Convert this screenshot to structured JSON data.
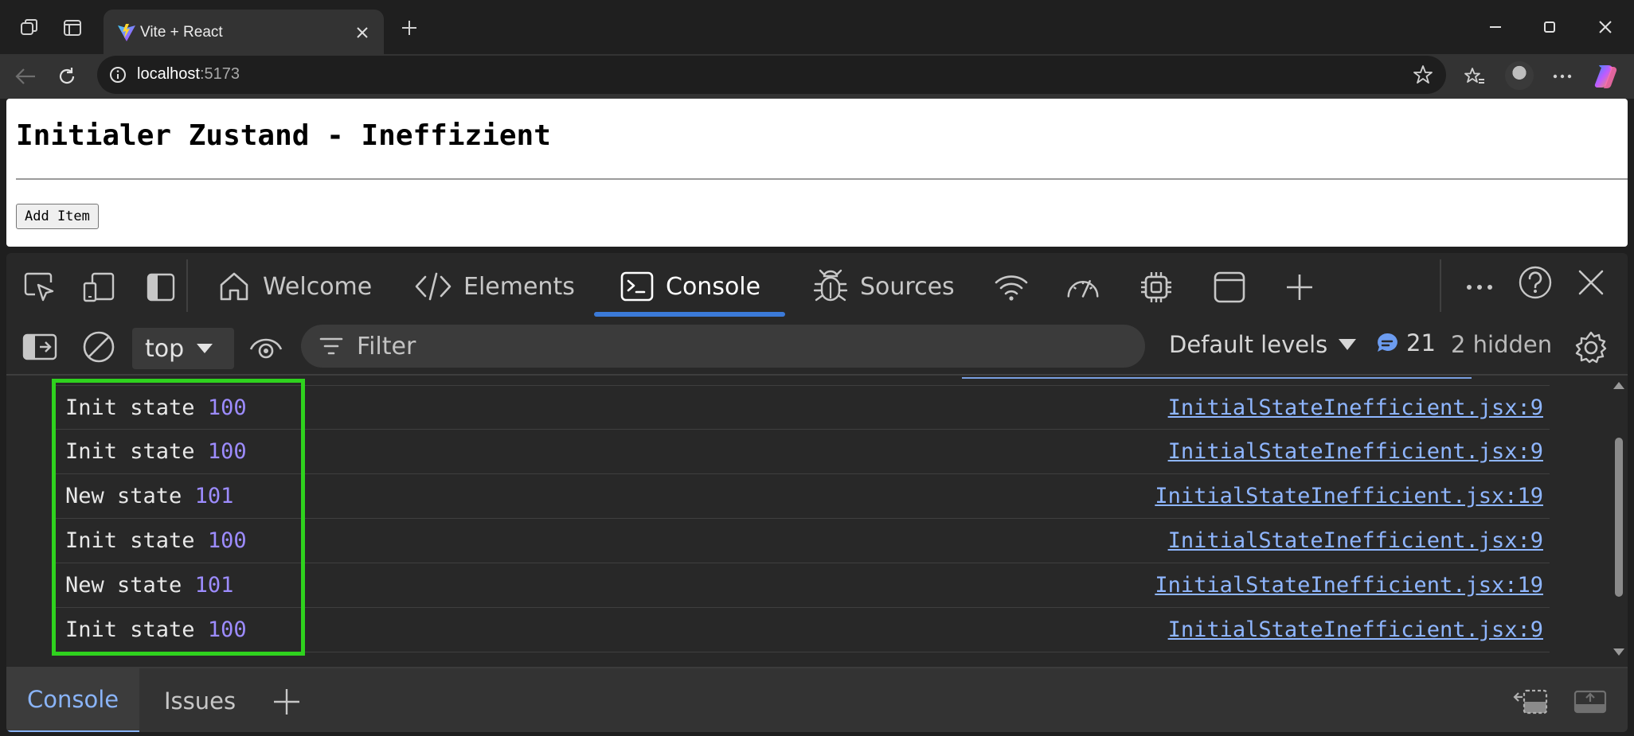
{
  "browser": {
    "tab_title": "Vite + React",
    "url_host": "localhost",
    "url_port": ":5173"
  },
  "page": {
    "heading": "Initialer Zustand - Ineffizient",
    "add_button_label": "Add Item"
  },
  "devtools": {
    "tabs": [
      {
        "label": "Welcome",
        "icon": "home-icon"
      },
      {
        "label": "Elements",
        "icon": "code-icon"
      },
      {
        "label": "Console",
        "icon": "terminal-icon",
        "active": true
      },
      {
        "label": "Sources",
        "icon": "bug-icon"
      }
    ],
    "context_select": "top",
    "filter_placeholder": "Filter",
    "levels_label": "Default levels",
    "message_count": "21",
    "hidden_label": "2 hidden",
    "console_rows": [
      {
        "text": "Init state",
        "value": "100",
        "source": "InitialStateInefficient.jsx:9"
      },
      {
        "text": "Init state",
        "value": "100",
        "source": "InitialStateInefficient.jsx:9"
      },
      {
        "text": "New state",
        "value": "101",
        "source": "InitialStateInefficient.jsx:19"
      },
      {
        "text": "Init state",
        "value": "100",
        "source": "InitialStateInefficient.jsx:9"
      },
      {
        "text": "New state",
        "value": "101",
        "source": "InitialStateInefficient.jsx:19"
      },
      {
        "text": "Init state",
        "value": "100",
        "source": "InitialStateInefficient.jsx:9"
      }
    ],
    "drawer_tabs": [
      {
        "label": "Console",
        "active": true
      },
      {
        "label": "Issues"
      }
    ],
    "colors": {
      "highlight_border": "#2fd21e",
      "active_tab_underline": "#3b7ad8",
      "console_number": "#9d8cff",
      "source_link": "#8fb6ff"
    }
  }
}
